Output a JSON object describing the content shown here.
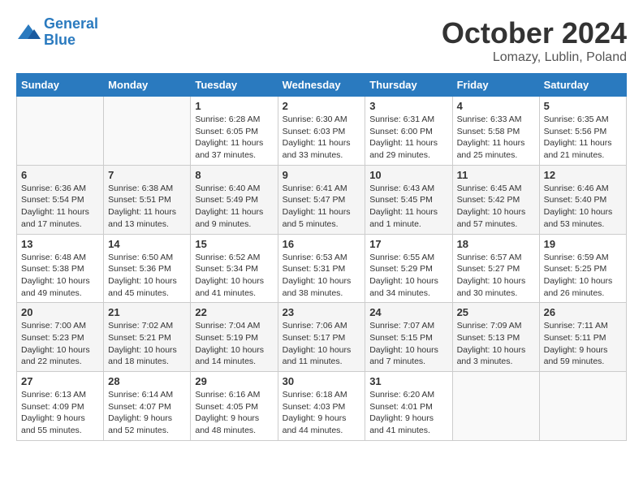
{
  "header": {
    "logo_line1": "General",
    "logo_line2": "Blue",
    "month": "October 2024",
    "location": "Lomazy, Lublin, Poland"
  },
  "weekdays": [
    "Sunday",
    "Monday",
    "Tuesday",
    "Wednesday",
    "Thursday",
    "Friday",
    "Saturday"
  ],
  "weeks": [
    [
      {
        "day": "",
        "info": ""
      },
      {
        "day": "",
        "info": ""
      },
      {
        "day": "1",
        "info": "Sunrise: 6:28 AM\nSunset: 6:05 PM\nDaylight: 11 hours and 37 minutes."
      },
      {
        "day": "2",
        "info": "Sunrise: 6:30 AM\nSunset: 6:03 PM\nDaylight: 11 hours and 33 minutes."
      },
      {
        "day": "3",
        "info": "Sunrise: 6:31 AM\nSunset: 6:00 PM\nDaylight: 11 hours and 29 minutes."
      },
      {
        "day": "4",
        "info": "Sunrise: 6:33 AM\nSunset: 5:58 PM\nDaylight: 11 hours and 25 minutes."
      },
      {
        "day": "5",
        "info": "Sunrise: 6:35 AM\nSunset: 5:56 PM\nDaylight: 11 hours and 21 minutes."
      }
    ],
    [
      {
        "day": "6",
        "info": "Sunrise: 6:36 AM\nSunset: 5:54 PM\nDaylight: 11 hours and 17 minutes."
      },
      {
        "day": "7",
        "info": "Sunrise: 6:38 AM\nSunset: 5:51 PM\nDaylight: 11 hours and 13 minutes."
      },
      {
        "day": "8",
        "info": "Sunrise: 6:40 AM\nSunset: 5:49 PM\nDaylight: 11 hours and 9 minutes."
      },
      {
        "day": "9",
        "info": "Sunrise: 6:41 AM\nSunset: 5:47 PM\nDaylight: 11 hours and 5 minutes."
      },
      {
        "day": "10",
        "info": "Sunrise: 6:43 AM\nSunset: 5:45 PM\nDaylight: 11 hours and 1 minute."
      },
      {
        "day": "11",
        "info": "Sunrise: 6:45 AM\nSunset: 5:42 PM\nDaylight: 10 hours and 57 minutes."
      },
      {
        "day": "12",
        "info": "Sunrise: 6:46 AM\nSunset: 5:40 PM\nDaylight: 10 hours and 53 minutes."
      }
    ],
    [
      {
        "day": "13",
        "info": "Sunrise: 6:48 AM\nSunset: 5:38 PM\nDaylight: 10 hours and 49 minutes."
      },
      {
        "day": "14",
        "info": "Sunrise: 6:50 AM\nSunset: 5:36 PM\nDaylight: 10 hours and 45 minutes."
      },
      {
        "day": "15",
        "info": "Sunrise: 6:52 AM\nSunset: 5:34 PM\nDaylight: 10 hours and 41 minutes."
      },
      {
        "day": "16",
        "info": "Sunrise: 6:53 AM\nSunset: 5:31 PM\nDaylight: 10 hours and 38 minutes."
      },
      {
        "day": "17",
        "info": "Sunrise: 6:55 AM\nSunset: 5:29 PM\nDaylight: 10 hours and 34 minutes."
      },
      {
        "day": "18",
        "info": "Sunrise: 6:57 AM\nSunset: 5:27 PM\nDaylight: 10 hours and 30 minutes."
      },
      {
        "day": "19",
        "info": "Sunrise: 6:59 AM\nSunset: 5:25 PM\nDaylight: 10 hours and 26 minutes."
      }
    ],
    [
      {
        "day": "20",
        "info": "Sunrise: 7:00 AM\nSunset: 5:23 PM\nDaylight: 10 hours and 22 minutes."
      },
      {
        "day": "21",
        "info": "Sunrise: 7:02 AM\nSunset: 5:21 PM\nDaylight: 10 hours and 18 minutes."
      },
      {
        "day": "22",
        "info": "Sunrise: 7:04 AM\nSunset: 5:19 PM\nDaylight: 10 hours and 14 minutes."
      },
      {
        "day": "23",
        "info": "Sunrise: 7:06 AM\nSunset: 5:17 PM\nDaylight: 10 hours and 11 minutes."
      },
      {
        "day": "24",
        "info": "Sunrise: 7:07 AM\nSunset: 5:15 PM\nDaylight: 10 hours and 7 minutes."
      },
      {
        "day": "25",
        "info": "Sunrise: 7:09 AM\nSunset: 5:13 PM\nDaylight: 10 hours and 3 minutes."
      },
      {
        "day": "26",
        "info": "Sunrise: 7:11 AM\nSunset: 5:11 PM\nDaylight: 9 hours and 59 minutes."
      }
    ],
    [
      {
        "day": "27",
        "info": "Sunrise: 6:13 AM\nSunset: 4:09 PM\nDaylight: 9 hours and 55 minutes."
      },
      {
        "day": "28",
        "info": "Sunrise: 6:14 AM\nSunset: 4:07 PM\nDaylight: 9 hours and 52 minutes."
      },
      {
        "day": "29",
        "info": "Sunrise: 6:16 AM\nSunset: 4:05 PM\nDaylight: 9 hours and 48 minutes."
      },
      {
        "day": "30",
        "info": "Sunrise: 6:18 AM\nSunset: 4:03 PM\nDaylight: 9 hours and 44 minutes."
      },
      {
        "day": "31",
        "info": "Sunrise: 6:20 AM\nSunset: 4:01 PM\nDaylight: 9 hours and 41 minutes."
      },
      {
        "day": "",
        "info": ""
      },
      {
        "day": "",
        "info": ""
      }
    ]
  ]
}
